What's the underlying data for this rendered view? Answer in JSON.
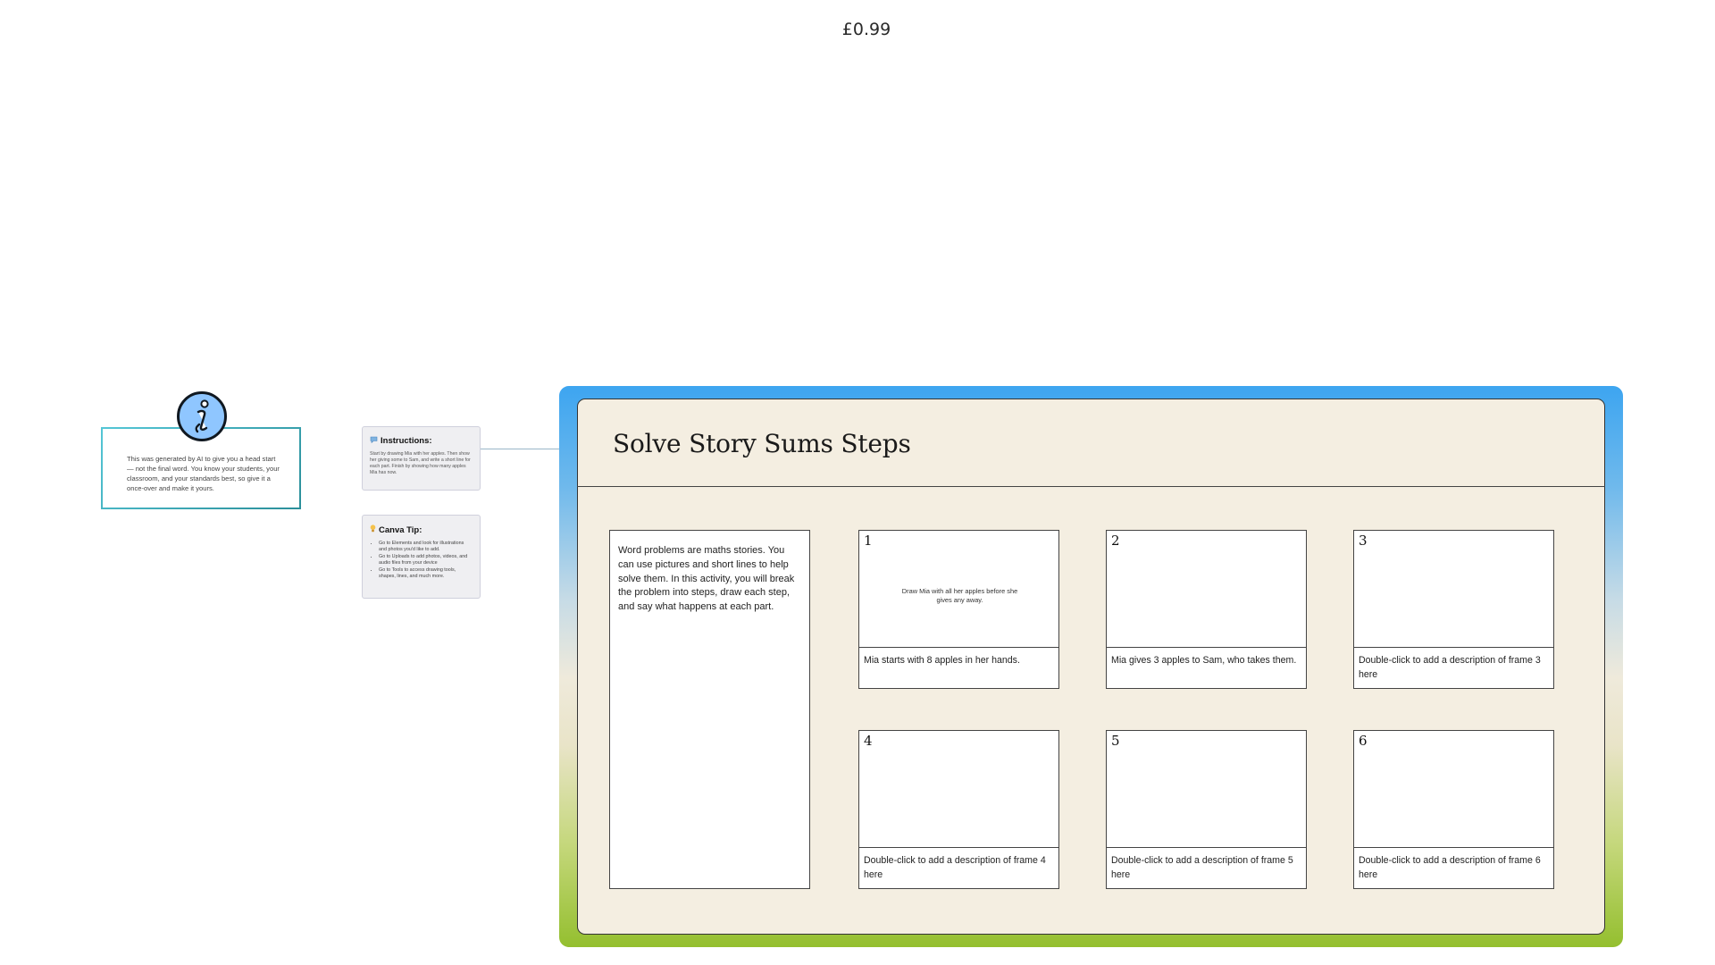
{
  "price": "£0.99",
  "info_note": {
    "icon": "info-icon",
    "text": "This was generated by AI to give you a head start — not the final word. You know your students, your classroom, and your standards best, so give it a once-over and make it yours."
  },
  "instructions": {
    "title": "Instructions:",
    "icon": "speech-bubble-icon",
    "body": "Start by drawing Mia with her apples. Then show her giving some to Sam, and write a short line for each part. Finish by showing how many apples Mia has now."
  },
  "canva_tip": {
    "title": "Canva Tip:",
    "icon": "lightbulb-icon",
    "items": [
      "Go to Elements and look for illustrations and photos you'd like to add.",
      "Go to Uploads to add photos, videos, and audio files from your device",
      "Go to Tools to access drawing tools, shapes, lines, and much more."
    ]
  },
  "storyboard": {
    "title": "Solve Story Sums Steps",
    "intro": "Word problems are maths stories. You can use pictures and short lines to help solve them. In this activity, you will break the problem into steps, draw each step, and say what happens at each part.",
    "frames": [
      {
        "number": "1",
        "picture_note": "Draw Mia with all her apples before she gives any away.",
        "caption": "Mia starts with 8 apples in her hands."
      },
      {
        "number": "2",
        "picture_note": "",
        "caption": "Mia gives 3 apples to Sam, who takes them."
      },
      {
        "number": "3",
        "picture_note": "",
        "caption": "Double-click to add a description of frame 3 here"
      },
      {
        "number": "4",
        "picture_note": "",
        "caption": "Double-click to add a description of frame 4 here"
      },
      {
        "number": "5",
        "picture_note": "",
        "caption": "Double-click to add a description of frame 5 here"
      },
      {
        "number": "6",
        "picture_note": "",
        "caption": "Double-click to add a description of frame 6 here"
      }
    ]
  },
  "colors": {
    "board_gradient_top": "#3da5f0",
    "board_gradient_bottom": "#94bf2f",
    "board_fill": "#f4eee1",
    "info_icon_fill": "#8fc6ff",
    "info_border": "#2b8f9a"
  }
}
